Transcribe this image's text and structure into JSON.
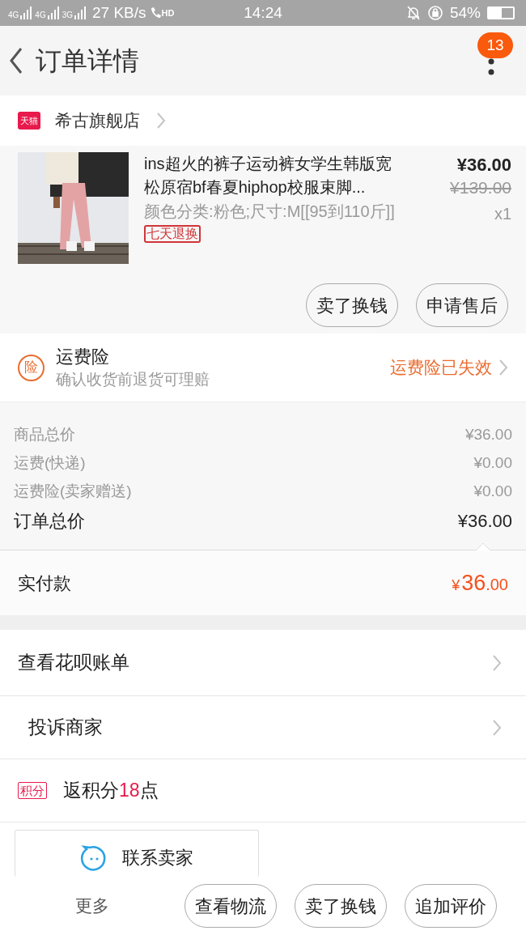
{
  "status_bar": {
    "left": [
      "4G",
      "4G",
      "3G"
    ],
    "speed": "27 KB/s",
    "call": "HD",
    "time": "14:24",
    "battery": "54%"
  },
  "header": {
    "title": "订单详情",
    "badge": "13"
  },
  "shop": {
    "badge": "天猫",
    "name": "希古旗舰店"
  },
  "product": {
    "title": "ins超火的裤子运动裤女学生韩版宽松原宿bf春夏hiphop校服束脚...",
    "spec": "颜色分类:粉色;尺寸:M[[95到110斤]]",
    "tag": "七天退换",
    "price": "¥36.00",
    "original_price": "¥139.00",
    "quantity": "x1",
    "buttons": [
      "卖了换钱",
      "申请售后"
    ]
  },
  "insurance": {
    "icon": "险",
    "title": "运费险",
    "subtitle": "确认收货前退货可理赔",
    "status": "运费险已失效"
  },
  "costs": [
    {
      "label": "商品总价",
      "value": "¥36.00"
    },
    {
      "label": "运费(快递)",
      "value": "¥0.00"
    },
    {
      "label": "运费险(卖家赠送)",
      "value": "¥0.00"
    }
  ],
  "total": {
    "label": "订单总价",
    "value": "¥36.00"
  },
  "paid": {
    "label": "实付款",
    "currency": "¥",
    "integer": "36",
    "decimal": ".00"
  },
  "links": [
    "查看花呗账单",
    "投诉商家"
  ],
  "points": {
    "badge": "积分",
    "text": "返积分**18**点"
  },
  "contact": {
    "label": "联系卖家"
  },
  "bottom_bar": {
    "more": "更多",
    "buttons": [
      "查看物流",
      "卖了换钱",
      "追加评价"
    ]
  }
}
